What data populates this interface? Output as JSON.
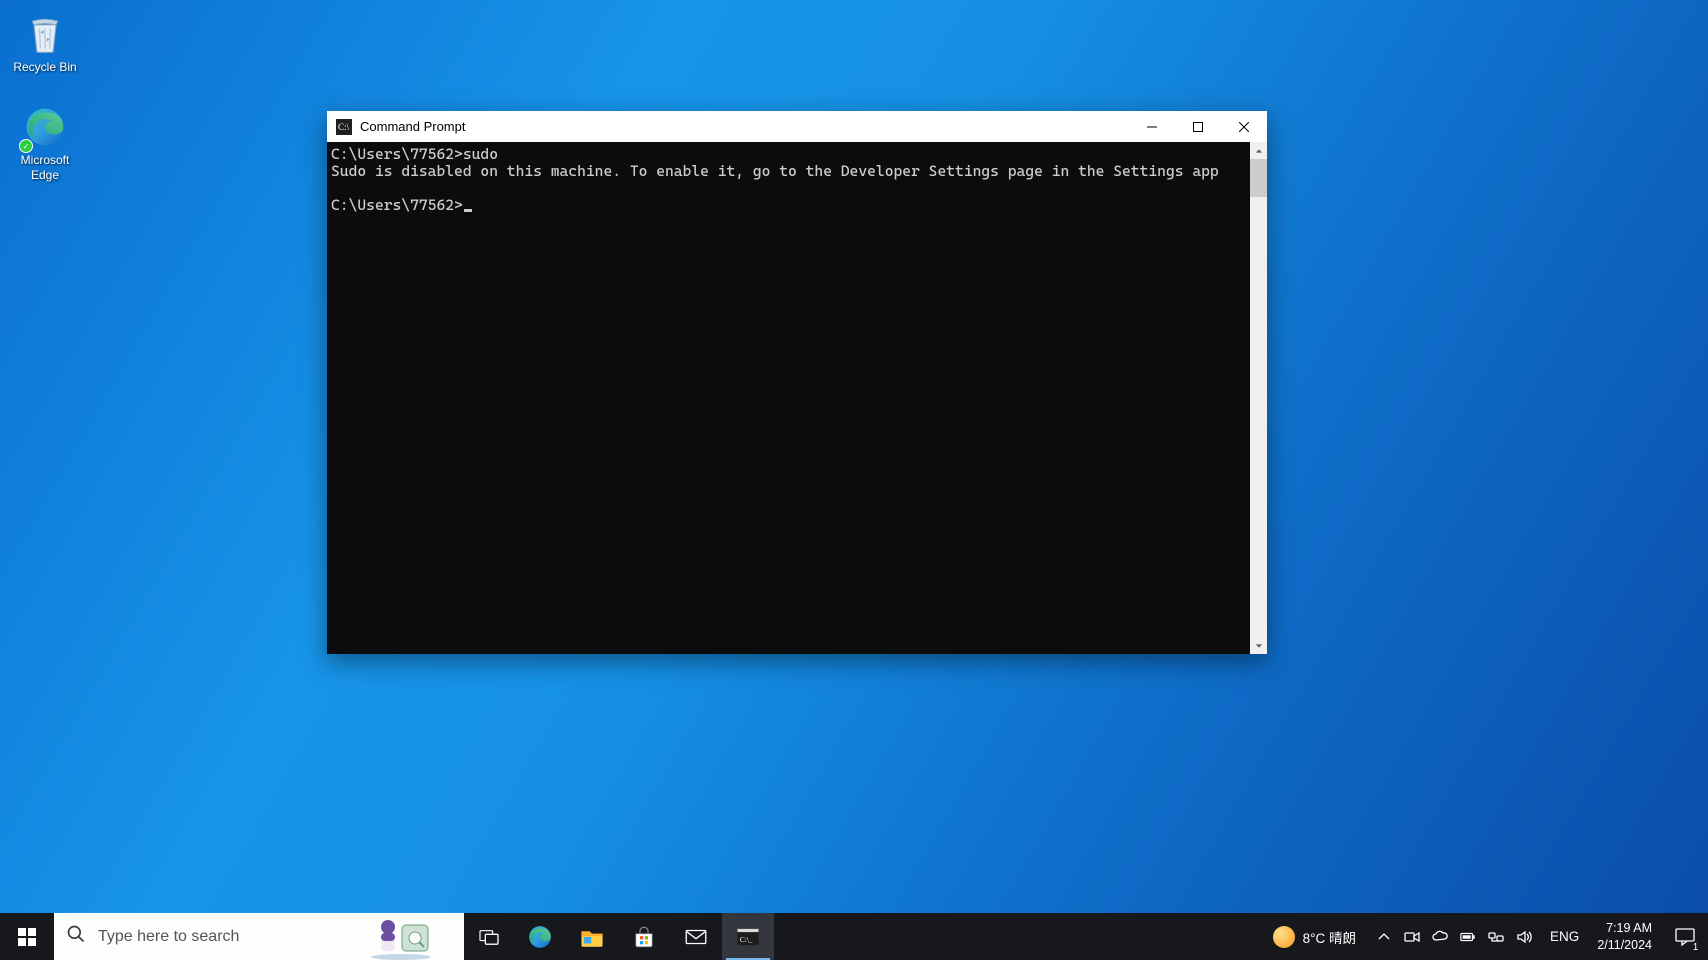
{
  "desktop": {
    "icons": [
      {
        "name": "Recycle Bin"
      },
      {
        "name": "Microsoft Edge"
      }
    ]
  },
  "window": {
    "title": "Command Prompt",
    "console": {
      "line1": "C:\\Users\\77562>sudo",
      "line2": "Sudo is disabled on this machine. To enable it, go to the Developer Settings page in the Settings app",
      "prompt": "C:\\Users\\77562>"
    }
  },
  "taskbar": {
    "search_placeholder": "Type here to search",
    "weather": "8°C 晴朗",
    "language": "ENG",
    "time": "7:19 AM",
    "date": "2/11/2024",
    "notif_count": "1"
  }
}
